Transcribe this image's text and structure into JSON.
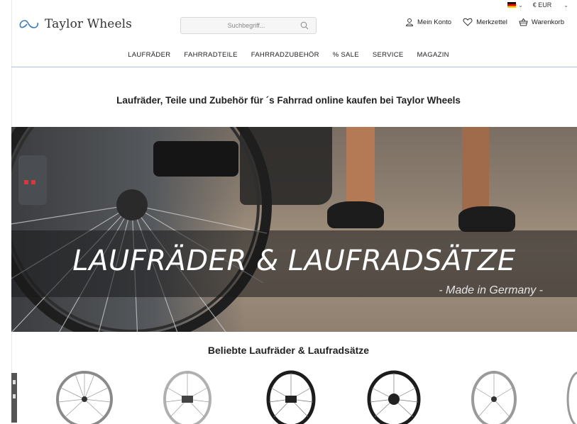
{
  "util": {
    "currency": "€ EUR",
    "language_icon": "german-flag-icon"
  },
  "header": {
    "brand": "Taylor Wheels",
    "search_placeholder": "Suchbegriff...",
    "account": "Mein Konto",
    "wishlist": "Merkzettel",
    "cart": "Warenkorb"
  },
  "nav": {
    "items": [
      "LAUFRÄDER",
      "FAHRRADTEILE",
      "FAHRRADZUBEHÖR",
      "% SALE",
      "SERVICE",
      "MAGAZIN"
    ]
  },
  "headline": "Laufräder, Teile und Zubehör für ´s Fahrrad online kaufen bei Taylor Wheels",
  "hero": {
    "title": "LAUFRÄDER & LAUFRADSÄTZE",
    "subtitle": "- Made in Germany -"
  },
  "section": {
    "title": "Beliebte Laufräder & Laufradsätze"
  },
  "colors": {
    "nav_line": "#a9c6de",
    "logo_blue": "#3c79b8"
  }
}
